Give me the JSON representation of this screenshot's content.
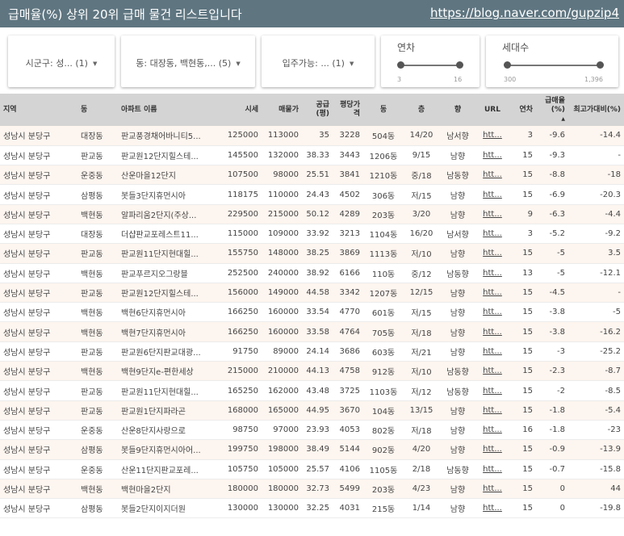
{
  "header": {
    "title": "급매율(%) 상위 20위 급매 물건 리스트입니다",
    "url": "https://blog.naver.com/gupzip4"
  },
  "filters": {
    "city": "시군구: 성... (1)",
    "dong": "동: 대장동, 백현동,... (5)",
    "movein": "입주가능: ... (1)",
    "year": {
      "label": "연차",
      "min": "3",
      "max": "16",
      "low": 3,
      "high": 16
    },
    "households": {
      "label": "세대수",
      "min": "300",
      "max": "1,396",
      "low": 300,
      "high": 1396
    }
  },
  "table": {
    "columns": [
      "지역",
      "동",
      "아파트 이름",
      "시세",
      "매물가",
      "공급(평)",
      "평당가격",
      "동",
      "층",
      "향",
      "URL",
      "연차",
      "급매율(%)",
      "최고가대비(%)"
    ],
    "rows": [
      [
        "성남시 분당구",
        "대장동",
        "판교풍경채어바니티5...",
        "125000",
        "113000",
        "35",
        "3228",
        "504동",
        "14/20",
        "남서향",
        "htt...",
        "3",
        "-9.6",
        "-14.4"
      ],
      [
        "성남시 분당구",
        "판교동",
        "판교원12단지힐스테...",
        "145500",
        "132000",
        "38.33",
        "3443",
        "1206동",
        "9/15",
        "남향",
        "htt...",
        "15",
        "-9.3",
        "-"
      ],
      [
        "성남시 분당구",
        "운중동",
        "산운마을12단지",
        "107500",
        "98000",
        "25.51",
        "3841",
        "1210동",
        "중/18",
        "남동향",
        "htt...",
        "15",
        "-8.8",
        "-18"
      ],
      [
        "성남시 분당구",
        "삼평동",
        "봇들3단지휴먼시아",
        "118175",
        "110000",
        "24.43",
        "4502",
        "306동",
        "저/15",
        "남향",
        "htt...",
        "15",
        "-6.9",
        "-20.3"
      ],
      [
        "성남시 분당구",
        "백현동",
        "알파리움2단지(주상...",
        "229500",
        "215000",
        "50.12",
        "4289",
        "203동",
        "3/20",
        "남향",
        "htt...",
        "9",
        "-6.3",
        "-4.4"
      ],
      [
        "성남시 분당구",
        "대장동",
        "더샵판교포레스트11...",
        "115000",
        "109000",
        "33.92",
        "3213",
        "1104동",
        "16/20",
        "남서향",
        "htt...",
        "3",
        "-5.2",
        "-9.2"
      ],
      [
        "성남시 분당구",
        "판교동",
        "판교원11단지현대힐...",
        "155750",
        "148000",
        "38.25",
        "3869",
        "1113동",
        "저/10",
        "남향",
        "htt...",
        "15",
        "-5",
        "3.5"
      ],
      [
        "성남시 분당구",
        "백현동",
        "판교푸르지오그랑블",
        "252500",
        "240000",
        "38.92",
        "6166",
        "110동",
        "중/12",
        "남동향",
        "htt...",
        "13",
        "-5",
        "-12.1"
      ],
      [
        "성남시 분당구",
        "판교동",
        "판교원12단지힐스테...",
        "156000",
        "149000",
        "44.58",
        "3342",
        "1207동",
        "12/15",
        "남향",
        "htt...",
        "15",
        "-4.5",
        "-"
      ],
      [
        "성남시 분당구",
        "백현동",
        "백현6단지휴먼시아",
        "166250",
        "160000",
        "33.54",
        "4770",
        "601동",
        "저/15",
        "남향",
        "htt...",
        "15",
        "-3.8",
        "-5"
      ],
      [
        "성남시 분당구",
        "백현동",
        "백현7단지휴먼시아",
        "166250",
        "160000",
        "33.58",
        "4764",
        "705동",
        "저/18",
        "남향",
        "htt...",
        "15",
        "-3.8",
        "-16.2"
      ],
      [
        "성남시 분당구",
        "판교동",
        "판교원6단지판교대광...",
        "91750",
        "89000",
        "24.14",
        "3686",
        "603동",
        "저/21",
        "남향",
        "htt...",
        "15",
        "-3",
        "-25.2"
      ],
      [
        "성남시 분당구",
        "백현동",
        "백현9단지e-편한세상",
        "215000",
        "210000",
        "44.13",
        "4758",
        "912동",
        "저/10",
        "남동향",
        "htt...",
        "15",
        "-2.3",
        "-8.7"
      ],
      [
        "성남시 분당구",
        "판교동",
        "판교원11단지현대힐...",
        "165250",
        "162000",
        "43.48",
        "3725",
        "1103동",
        "저/12",
        "남동향",
        "htt...",
        "15",
        "-2",
        "-8.5"
      ],
      [
        "성남시 분당구",
        "판교동",
        "판교원1단지파라곤",
        "168000",
        "165000",
        "44.95",
        "3670",
        "104동",
        "13/15",
        "남향",
        "htt...",
        "15",
        "-1.8",
        "-5.4"
      ],
      [
        "성남시 분당구",
        "운중동",
        "산운8단지사랑으로",
        "98750",
        "97000",
        "23.93",
        "4053",
        "802동",
        "저/18",
        "남향",
        "htt...",
        "16",
        "-1.8",
        "-23"
      ],
      [
        "성남시 분당구",
        "삼평동",
        "봇들9단지휴먼시아어...",
        "199750",
        "198000",
        "38.49",
        "5144",
        "902동",
        "4/20",
        "남향",
        "htt...",
        "15",
        "-0.9",
        "-13.9"
      ],
      [
        "성남시 분당구",
        "운중동",
        "산운11단지판교포레...",
        "105750",
        "105000",
        "25.57",
        "4106",
        "1105동",
        "2/18",
        "남동향",
        "htt...",
        "15",
        "-0.7",
        "-15.8"
      ],
      [
        "성남시 분당구",
        "백현동",
        "백현마을2단지",
        "180000",
        "180000",
        "32.73",
        "5499",
        "203동",
        "4/23",
        "남향",
        "htt...",
        "15",
        "0",
        "44"
      ],
      [
        "성남시 분당구",
        "삼평동",
        "봇들2단지이지더원",
        "130000",
        "130000",
        "32.25",
        "4031",
        "215동",
        "1/14",
        "남향",
        "htt...",
        "15",
        "0",
        "-19.8"
      ]
    ]
  }
}
